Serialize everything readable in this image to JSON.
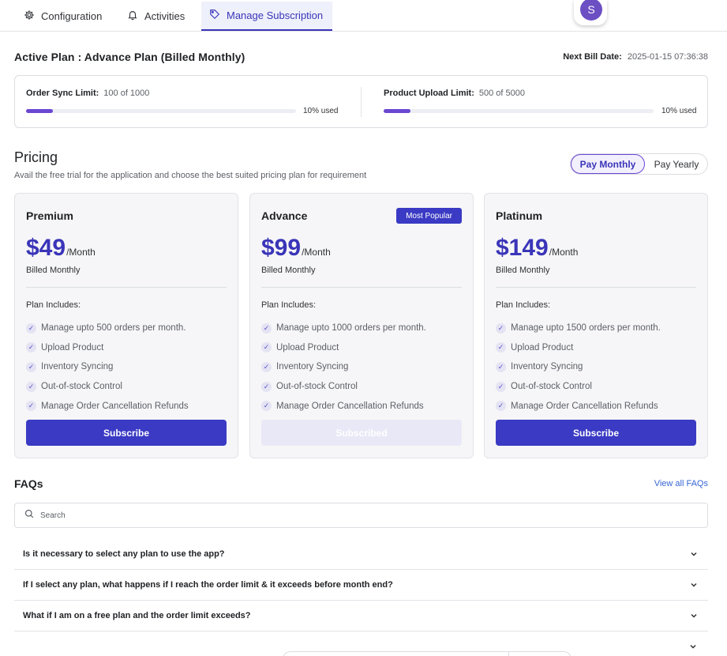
{
  "nav": {
    "tabs": [
      {
        "label": "Configuration",
        "icon": "gear-icon"
      },
      {
        "label": "Activities",
        "icon": "bell-icon"
      },
      {
        "label": "Manage Subscription",
        "icon": "tag-icon",
        "active": true
      }
    ],
    "avatar_initial": "S"
  },
  "active_plan": {
    "title": "Active Plan : Advance Plan (Billed Monthly)",
    "next_bill_label": "Next Bill Date:",
    "next_bill_value": "2025-01-15 07:36:38"
  },
  "limits": [
    {
      "label": "Order Sync Limit:",
      "value": "100 of 1000",
      "used_text": "10% used",
      "used_fraction": 0.1
    },
    {
      "label": "Product Upload Limit:",
      "value": "500 of 5000",
      "used_text": "10% used",
      "used_fraction": 0.1
    }
  ],
  "pricing": {
    "title": "Pricing",
    "subtitle": "Avail the free trial for the application and choose the best suited pricing plan for requirement",
    "toggle": {
      "monthly": "Pay Monthly",
      "yearly": "Pay Yearly",
      "selected": "monthly"
    }
  },
  "plans": [
    {
      "name": "Premium",
      "badge": "",
      "price": "$49",
      "per": "/Month",
      "billed": "Billed Monthly",
      "includes_label": "Plan Includes:",
      "features": [
        "Manage upto 500 orders per month.",
        "Upload Product",
        "Inventory Syncing",
        "Out-of-stock Control",
        "Manage Order Cancellation Refunds"
      ],
      "button": "Subscribe",
      "button_state": "enabled"
    },
    {
      "name": "Advance",
      "badge": "Most Popular",
      "price": "$99",
      "per": "/Month",
      "billed": "Billed Monthly",
      "includes_label": "Plan Includes:",
      "features": [
        "Manage upto 1000 orders per month.",
        "Upload Product",
        "Inventory Syncing",
        "Out-of-stock Control",
        "Manage Order Cancellation Refunds"
      ],
      "button": "Subscribed",
      "button_state": "disabled"
    },
    {
      "name": "Platinum",
      "badge": "",
      "price": "$149",
      "per": "/Month",
      "billed": "Billed Monthly",
      "includes_label": "Plan Includes:",
      "features": [
        "Manage upto 1500 orders per month.",
        "Upload Product",
        "Inventory Syncing",
        "Out-of-stock Control",
        "Manage Order Cancellation Refunds"
      ],
      "button": "Subscribe",
      "button_state": "enabled"
    }
  ],
  "faqs": {
    "title": "FAQs",
    "view_all": "View all FAQs",
    "search_placeholder": "Search",
    "items": [
      "Is it necessary to select any plan to use the app?",
      "If I select any plan, what happens if I reach the order limit & it exceeds before month end?",
      "What if I am on a free plan and the order limit exceeds?"
    ]
  },
  "colors": {
    "accent": "#3a3ac4",
    "progress": "#6a47d1",
    "avatar": "#6b4fc3",
    "link": "#3565d4"
  }
}
